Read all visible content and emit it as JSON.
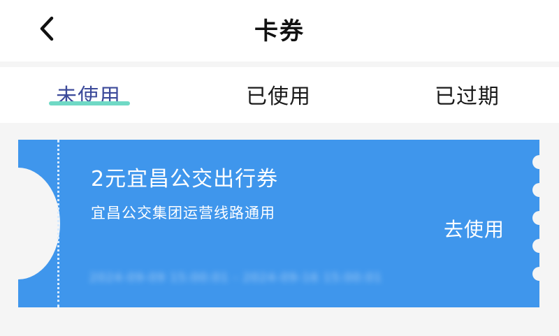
{
  "header": {
    "title": "卡券",
    "back_icon": "chevron-left-icon"
  },
  "tabs": [
    {
      "label": "未使用",
      "active": true
    },
    {
      "label": "已使用",
      "active": false
    },
    {
      "label": "已过期",
      "active": false
    }
  ],
  "coupon": {
    "title": "2元宜昌公交出行券",
    "description": "宜昌公交集团运营线路通用",
    "validity": "2024-09-09 15:00:01 - 2024-09-16 15:00:01",
    "action_label": "去使用"
  },
  "colors": {
    "coupon_background": "#3f96ec",
    "tab_active_text": "#3c4a9a",
    "tab_indicator": "#6fd9c5",
    "page_background": "#f5f5f5"
  }
}
